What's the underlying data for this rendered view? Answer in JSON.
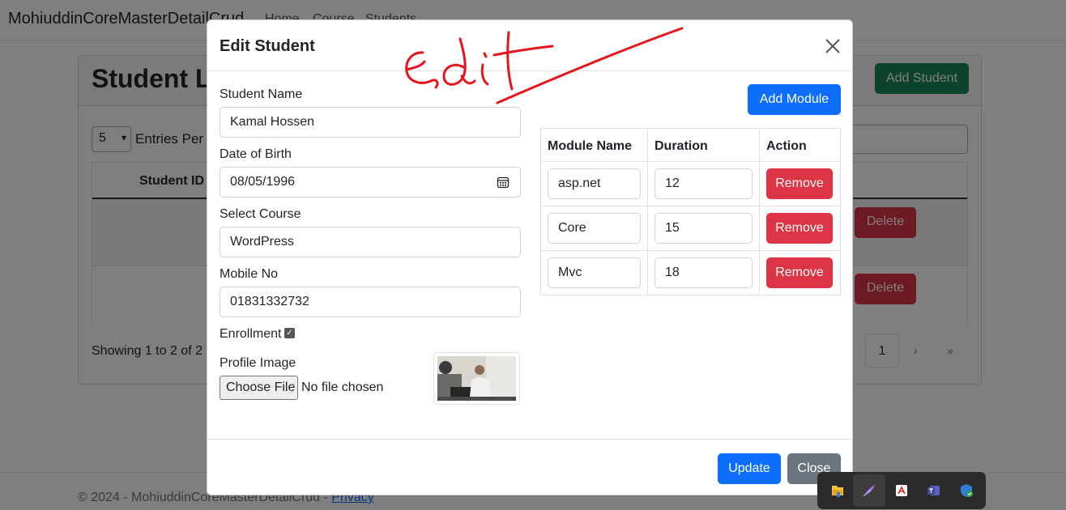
{
  "navbar": {
    "brand": "MohiuddinCoreMasterDetailCrud",
    "links": [
      "Home",
      "Course",
      "Students"
    ]
  },
  "page": {
    "title": "Student List",
    "add_student_label": "Add Student",
    "entries_value": "5",
    "entries_label": "Entries Per Page",
    "table_header_student_id": "Student ID",
    "delete_label": "Delete",
    "showing_text": "Showing 1 to 2 of 2 entries",
    "pagination": {
      "current": "1",
      "next": "›",
      "last": "»"
    }
  },
  "footer": {
    "text": "© 2024 - MohiuddinCoreMasterDetailCrud - ",
    "privacy": "Privacy"
  },
  "modal": {
    "title": "Edit Student",
    "fields": {
      "student_name_label": "Student Name",
      "student_name_value": "Kamal Hossen",
      "dob_label": "Date of Birth",
      "dob_value": "08/05/1996",
      "course_label": "Select Course",
      "course_value": "WordPress",
      "mobile_label": "Mobile No",
      "mobile_value": "01831332732",
      "enrollment_label": "Enrollment",
      "enrollment_checked": true,
      "profile_image_label": "Profile Image",
      "choose_file_label": "Choose File",
      "no_file_text": "No file chosen"
    },
    "add_module_label": "Add Module",
    "modules_table": {
      "headers": [
        "Module Name",
        "Duration",
        "Action"
      ],
      "rows": [
        {
          "name": "asp.net",
          "duration": "12",
          "action": "Remove"
        },
        {
          "name": "Core",
          "duration": "15",
          "action": "Remove"
        },
        {
          "name": "Mvc",
          "duration": "18",
          "action": "Remove"
        }
      ]
    },
    "update_label": "Update",
    "close_label": "Close"
  },
  "tray_icons": [
    "file-explorer-icon",
    "feather-app-icon",
    "pdf-reader-icon",
    "teams-icon",
    "security-shield-icon"
  ],
  "colors": {
    "primary": "#0d6efd",
    "danger": "#dc3545",
    "success": "#198754",
    "secondary": "#6c757d",
    "annotation": "#e8141c"
  }
}
